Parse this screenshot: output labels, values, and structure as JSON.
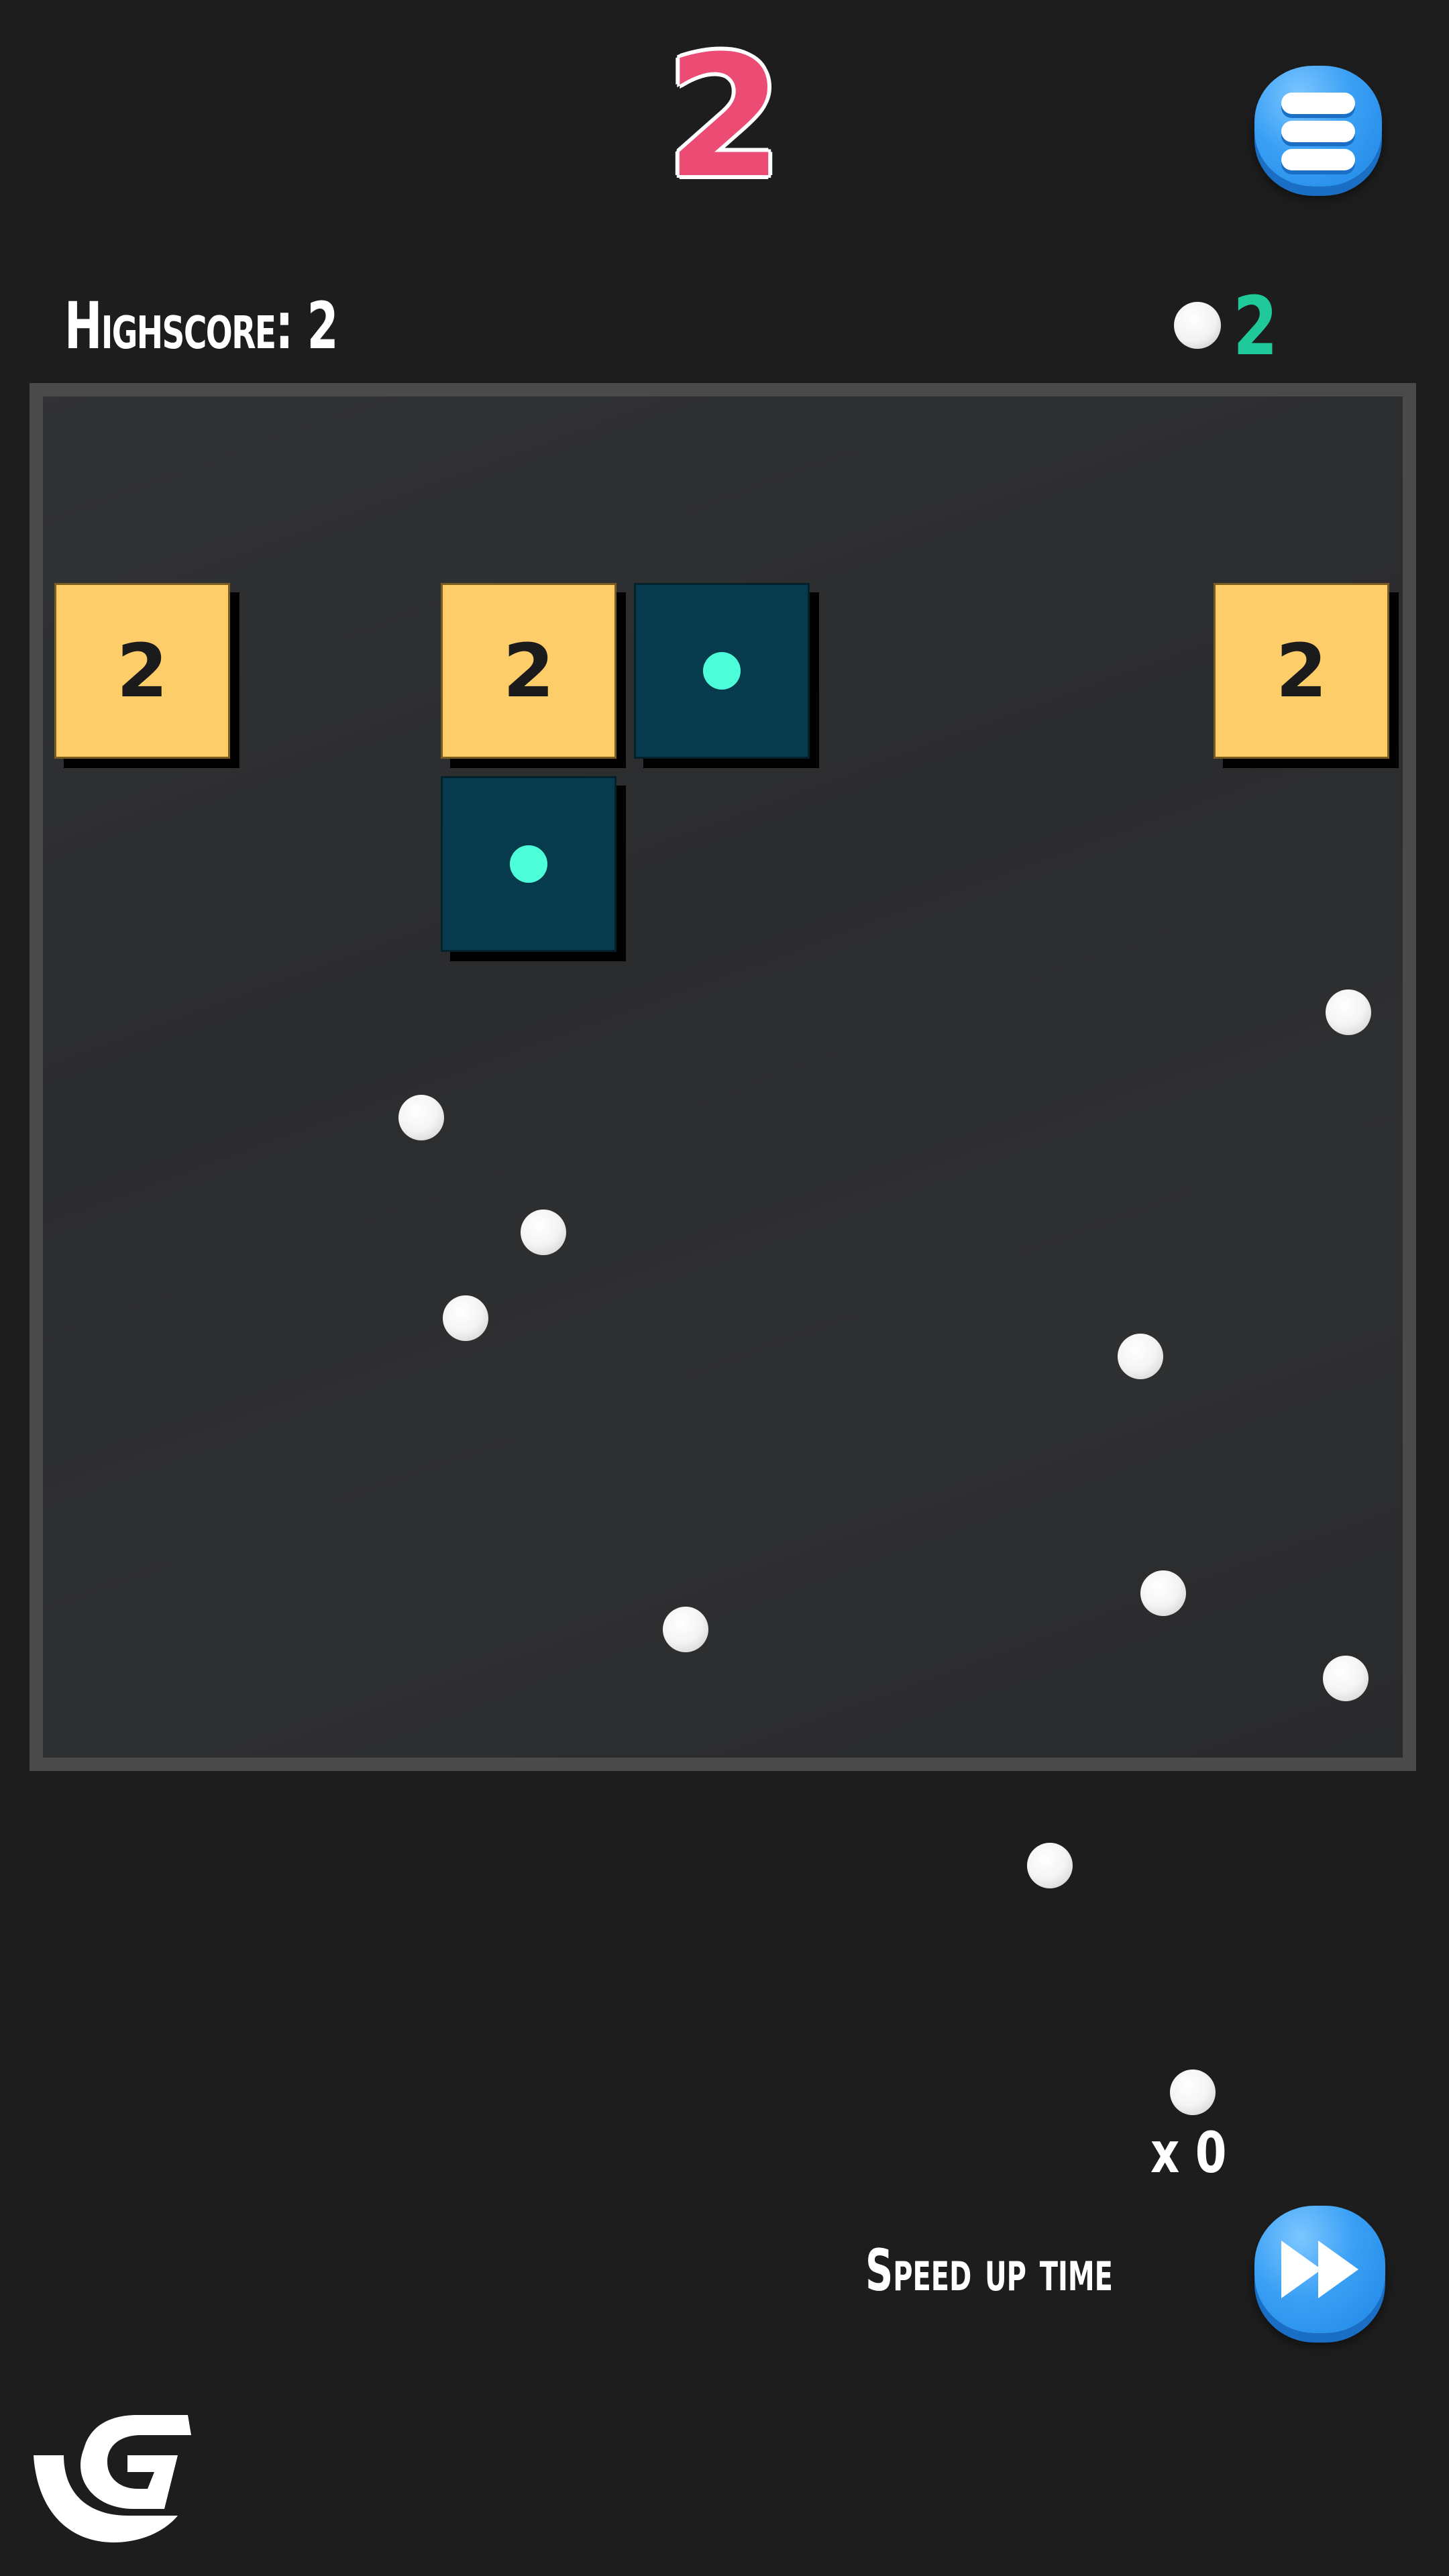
{
  "hud": {
    "score": "2",
    "highscore_label": "Highscore:",
    "highscore_value": "2",
    "ball_count": "2",
    "menu_icon": "hamburger-menu-icon"
  },
  "colors": {
    "score": "#ec4c74",
    "ball_count": "#1fc99a",
    "number_block": "#fdcd6a",
    "pickup_block": "#063a4c",
    "pickup_dot": "#4dffd8",
    "button_blue": "#3aa0f5",
    "board_border": "#4a4a4a",
    "background": "#1d1d1d"
  },
  "board": {
    "grid_columns": 7,
    "blocks": [
      {
        "type": "number",
        "col": 0,
        "row": 0,
        "value": "2"
      },
      {
        "type": "number",
        "col": 2,
        "row": 0,
        "value": "2"
      },
      {
        "type": "pickup",
        "col": 3,
        "row": 0
      },
      {
        "type": "number",
        "col": 6,
        "row": 0,
        "value": "2"
      },
      {
        "type": "pickup",
        "col": 2,
        "row": 1
      }
    ],
    "ball_count_in_play": 10
  },
  "footer": {
    "multiplier": "x 0",
    "speed_up_label": "Speed up time",
    "speed_up_icon": "fast-forward-icon",
    "logo": "gamedistribution-logo"
  }
}
